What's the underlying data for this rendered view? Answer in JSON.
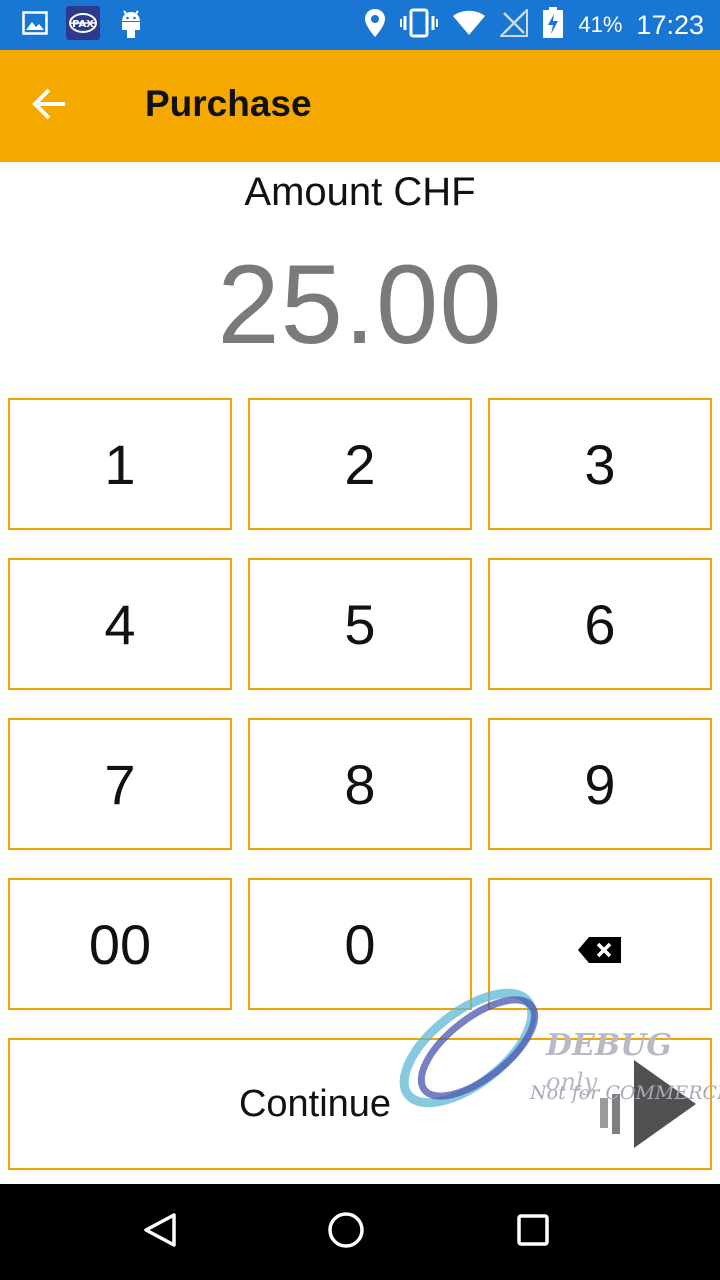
{
  "status_bar": {
    "icons_left": [
      "gallery-icon",
      "pax-app-icon",
      "android-icon"
    ],
    "icons_right": [
      "location-icon",
      "vibrate-icon",
      "wifi-icon",
      "no-signal-icon",
      "battery-charging-icon"
    ],
    "battery": "41%",
    "time": "17:23"
  },
  "app_bar": {
    "back_icon": "arrow-left-icon",
    "title": "Purchase",
    "color": "#f5a800"
  },
  "amount": {
    "label": "Amount CHF",
    "value": "25.00"
  },
  "keypad": {
    "keys": [
      "1",
      "2",
      "3",
      "4",
      "5",
      "6",
      "7",
      "8",
      "9",
      "00",
      "0"
    ],
    "backspace_icon": "backspace-icon",
    "border_color": "#f0a500"
  },
  "continue_label": "Continue",
  "watermark": {
    "line1_bold": "DEBUG",
    "line1_small": "only",
    "line2": "Not for COMMERCIAL"
  },
  "nav_bar": {
    "icons": [
      "back-triangle-icon",
      "home-circle-icon",
      "recents-square-icon"
    ]
  }
}
